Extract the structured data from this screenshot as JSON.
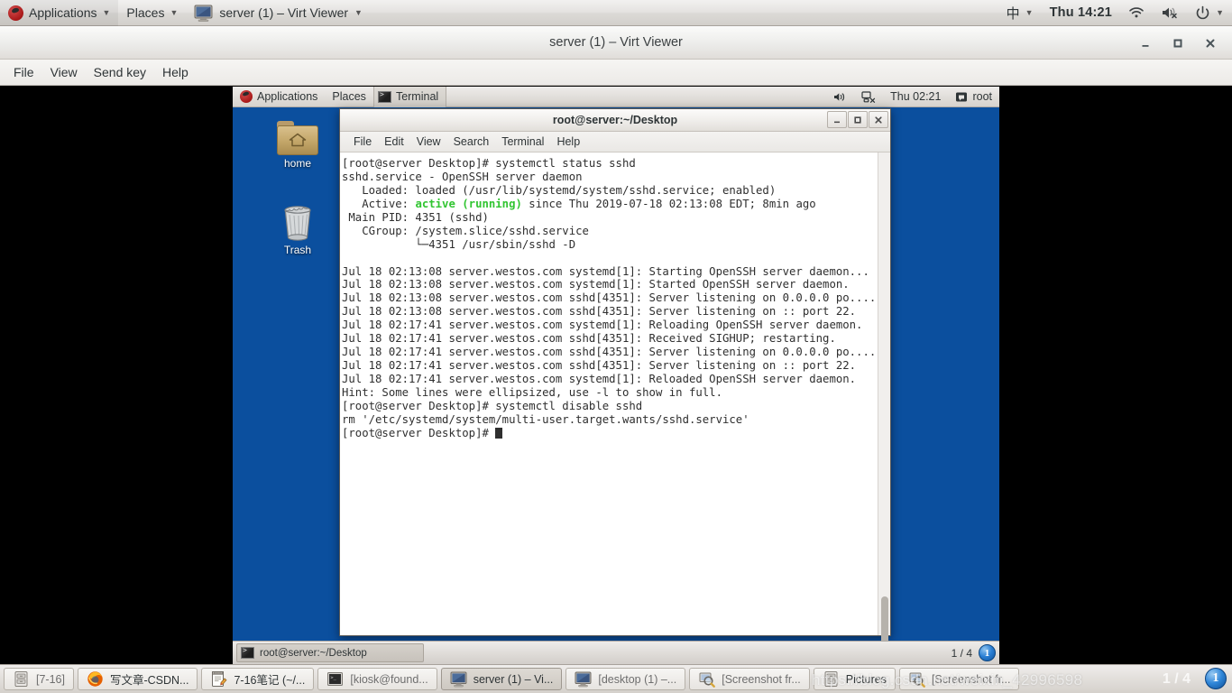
{
  "host_panel": {
    "logo": "fedora-logo",
    "applications": "Applications",
    "places": "Places",
    "window_title": "server (1) – Virt Viewer",
    "ime": "中",
    "clock": "Thu 14:21",
    "icons": [
      "wifi-icon",
      "volume-muted-icon",
      "power-icon"
    ]
  },
  "virt_viewer": {
    "title": "server (1) – Virt Viewer",
    "menus": [
      "File",
      "View",
      "Send key",
      "Help"
    ],
    "controls": {
      "minimize": "_",
      "maximize": "□",
      "close": "✕"
    }
  },
  "vm_panel": {
    "applications": "Applications",
    "places": "Places",
    "window_button": "Terminal",
    "clock": "Thu 02:21",
    "user": "root"
  },
  "desktop": {
    "background_color": "#0b4f9e",
    "icons": [
      {
        "name": "home",
        "label": "home"
      },
      {
        "name": "trash",
        "label": "Trash"
      }
    ]
  },
  "terminal": {
    "title": "root@server:~/Desktop",
    "menus": [
      "File",
      "Edit",
      "View",
      "Search",
      "Terminal",
      "Help"
    ],
    "controls": {
      "minimize": "_",
      "maximize": "□",
      "close": "✕"
    },
    "green_color": "#31c531",
    "lines": [
      {
        "text": "[root@server Desktop]# systemctl status sshd"
      },
      {
        "text": "sshd.service - OpenSSH server daemon"
      },
      {
        "text": "   Loaded: loaded (/usr/lib/systemd/system/sshd.service; enabled)"
      },
      {
        "pre": "   Active: ",
        "green": "active (running)",
        "post": " since Thu 2019-07-18 02:13:08 EDT; 8min ago"
      },
      {
        "text": " Main PID: 4351 (sshd)"
      },
      {
        "text": "   CGroup: /system.slice/sshd.service"
      },
      {
        "text": "           └─4351 /usr/sbin/sshd -D"
      },
      {
        "text": ""
      },
      {
        "text": "Jul 18 02:13:08 server.westos.com systemd[1]: Starting OpenSSH server daemon..."
      },
      {
        "text": "Jul 18 02:13:08 server.westos.com systemd[1]: Started OpenSSH server daemon."
      },
      {
        "text": "Jul 18 02:13:08 server.westos.com sshd[4351]: Server listening on 0.0.0.0 po...."
      },
      {
        "text": "Jul 18 02:13:08 server.westos.com sshd[4351]: Server listening on :: port 22."
      },
      {
        "text": "Jul 18 02:17:41 server.westos.com systemd[1]: Reloading OpenSSH server daemon."
      },
      {
        "text": "Jul 18 02:17:41 server.westos.com sshd[4351]: Received SIGHUP; restarting."
      },
      {
        "text": "Jul 18 02:17:41 server.westos.com sshd[4351]: Server listening on 0.0.0.0 po...."
      },
      {
        "text": "Jul 18 02:17:41 server.westos.com sshd[4351]: Server listening on :: port 22."
      },
      {
        "text": "Jul 18 02:17:41 server.westos.com systemd[1]: Reloaded OpenSSH server daemon."
      },
      {
        "text": "Hint: Some lines were ellipsized, use -l to show in full."
      },
      {
        "text": "[root@server Desktop]# systemctl disable sshd"
      },
      {
        "text": "rm '/etc/systemd/system/multi-user.target.wants/sshd.service'"
      },
      {
        "prompt": "[root@server Desktop]# ",
        "cursor": true
      }
    ]
  },
  "vm_bottom_panel": {
    "task_button": "root@server:~/Desktop",
    "workspace": "1 / 4",
    "orb_label": "1"
  },
  "host_taskbar": {
    "items": [
      {
        "label": "[7-16]",
        "icon": "file-manager-icon",
        "active": false,
        "dim": true
      },
      {
        "label": "写文章-CSDN...",
        "icon": "firefox-icon",
        "active": false,
        "dim": false
      },
      {
        "label": "7-16笔记 (~/...",
        "icon": "text-editor-icon",
        "active": false,
        "dim": false
      },
      {
        "label": "[kiosk@found...",
        "icon": "terminal-icon",
        "active": false,
        "dim": true
      },
      {
        "label": "server (1) – Vi...",
        "icon": "display-icon",
        "active": true,
        "dim": false
      },
      {
        "label": "[desktop (1) –...",
        "icon": "display-icon",
        "active": false,
        "dim": true
      },
      {
        "label": "[Screenshot fr...",
        "icon": "screenshot-icon",
        "active": false,
        "dim": true
      },
      {
        "label": "Pictures",
        "icon": "file-manager-icon",
        "active": false,
        "dim": false
      },
      {
        "label": "[Screenshot fr...",
        "icon": "screenshot-icon",
        "active": false,
        "dim": true
      }
    ]
  },
  "watermark": {
    "url": "https://blog.csdn.net/weixin_42996598",
    "counter": "1 / 4",
    "orb_label": "1"
  }
}
